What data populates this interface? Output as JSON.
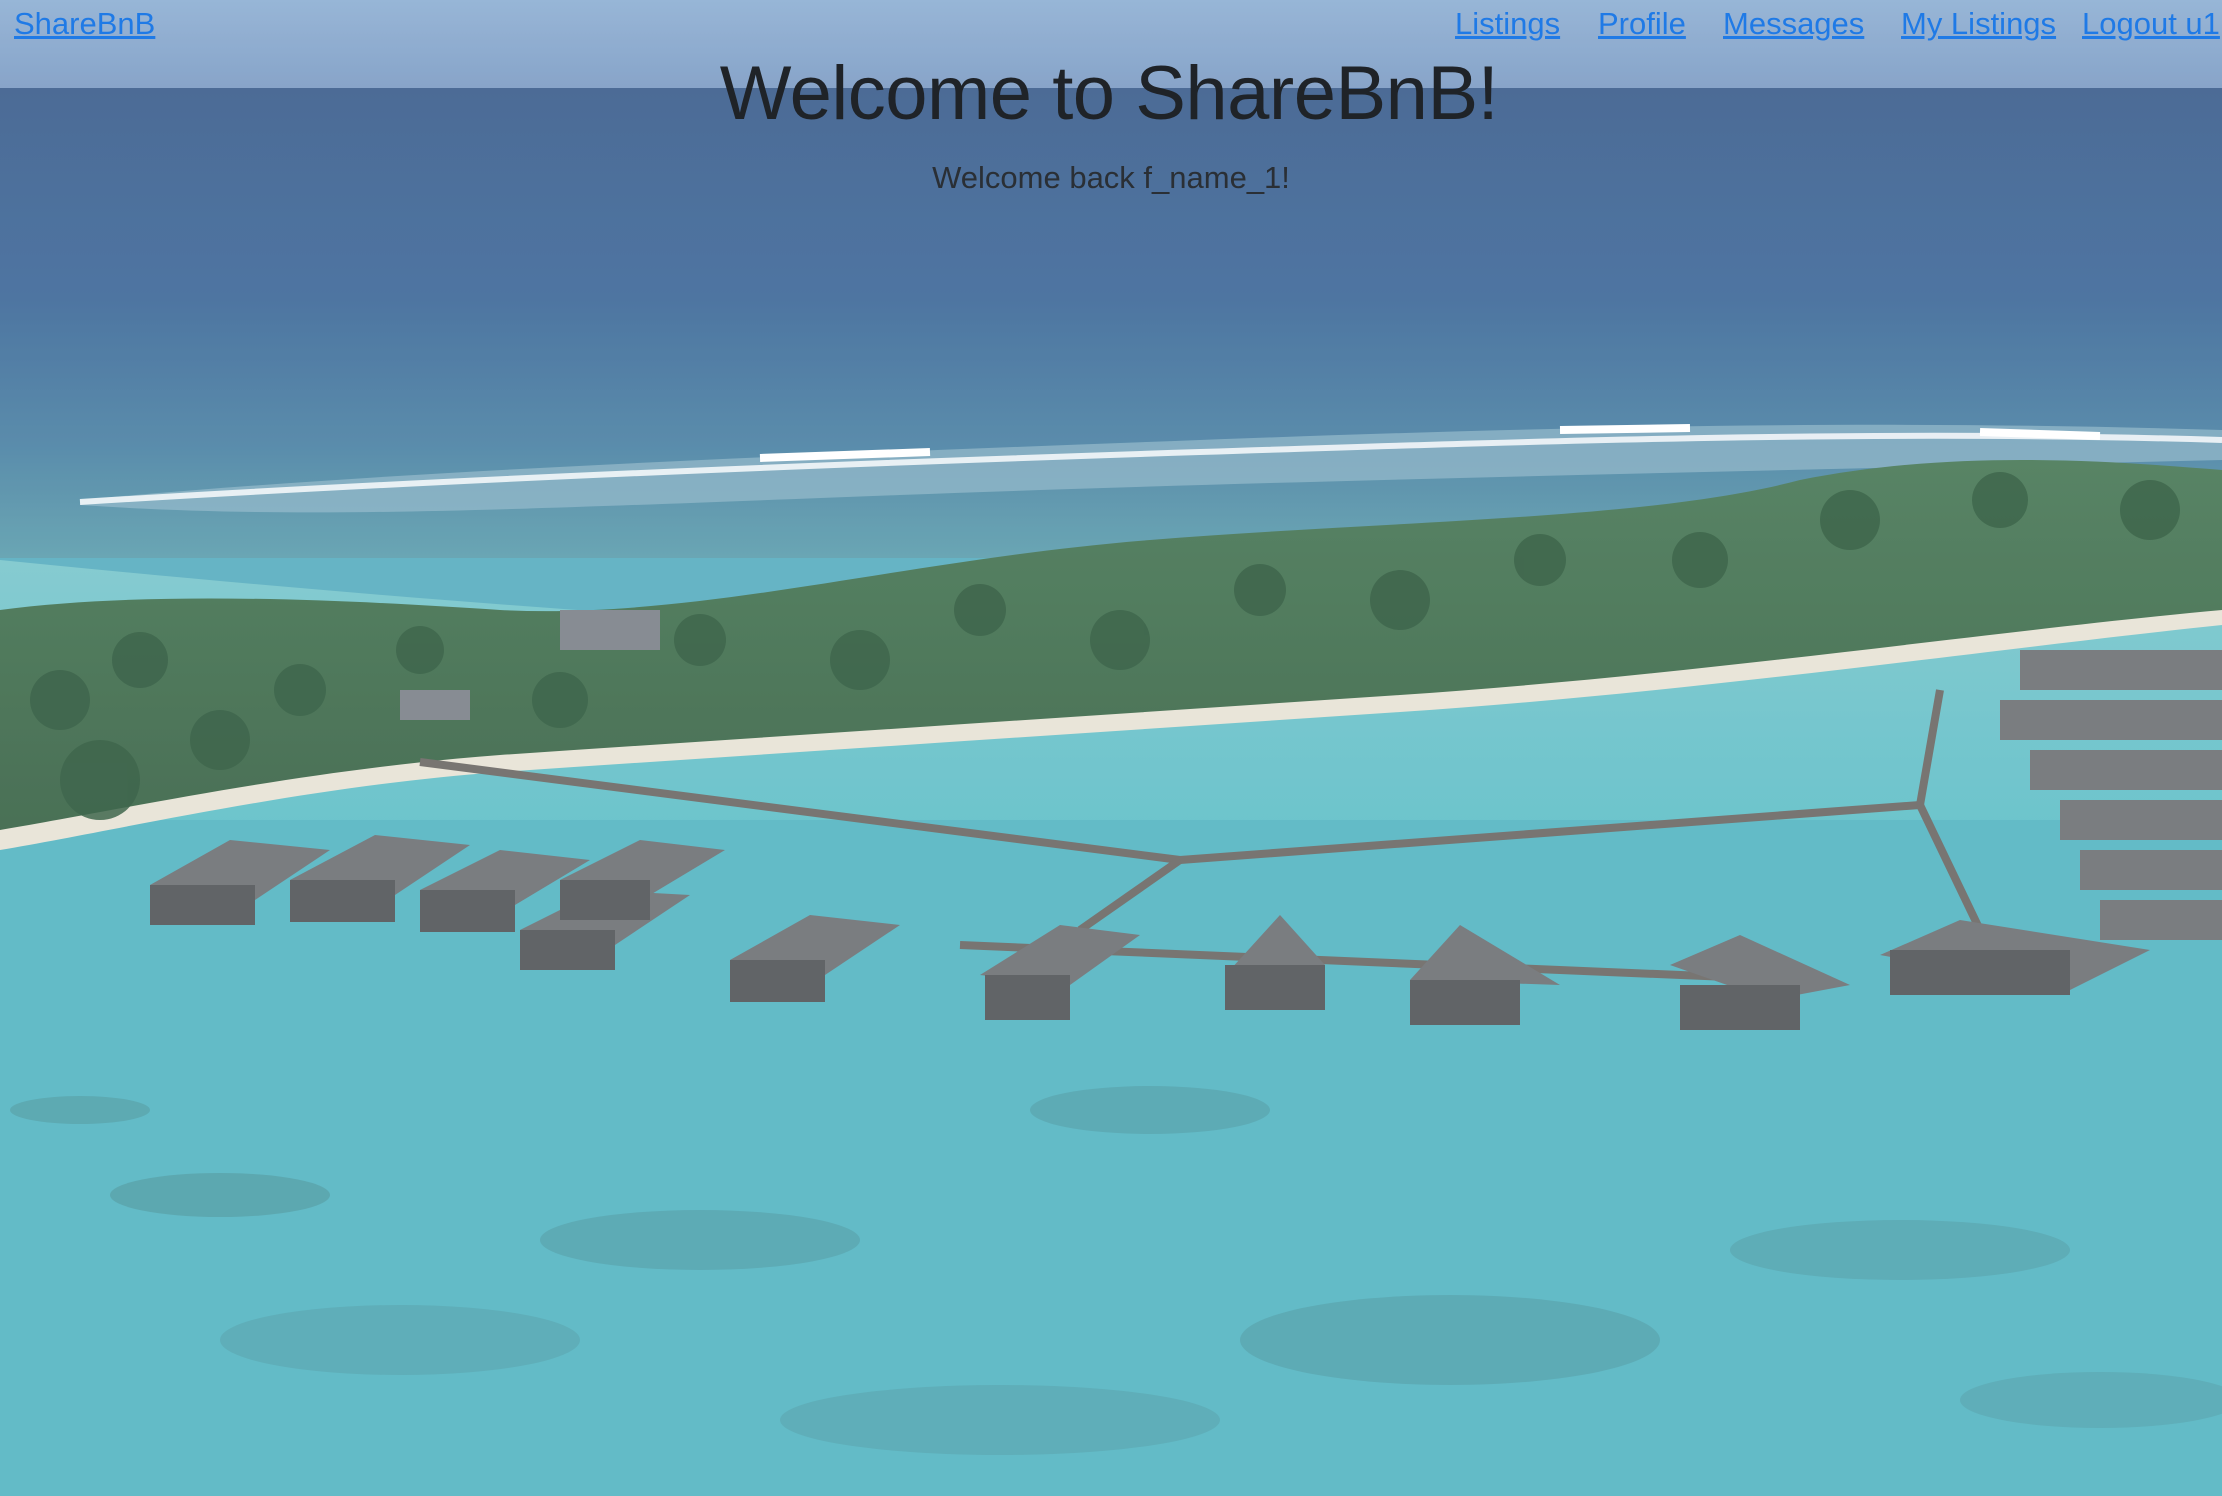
{
  "navbar": {
    "brand": "ShareBnB",
    "links": [
      "Listings",
      "Profile",
      "Messages",
      "My Listings",
      "Logout u1"
    ]
  },
  "hero": {
    "title": "Welcome to ShareBnB!",
    "subtitle": "Welcome back f_name_1!"
  },
  "colors": {
    "link": "#1f7ae6",
    "heading": "#1f2328"
  }
}
